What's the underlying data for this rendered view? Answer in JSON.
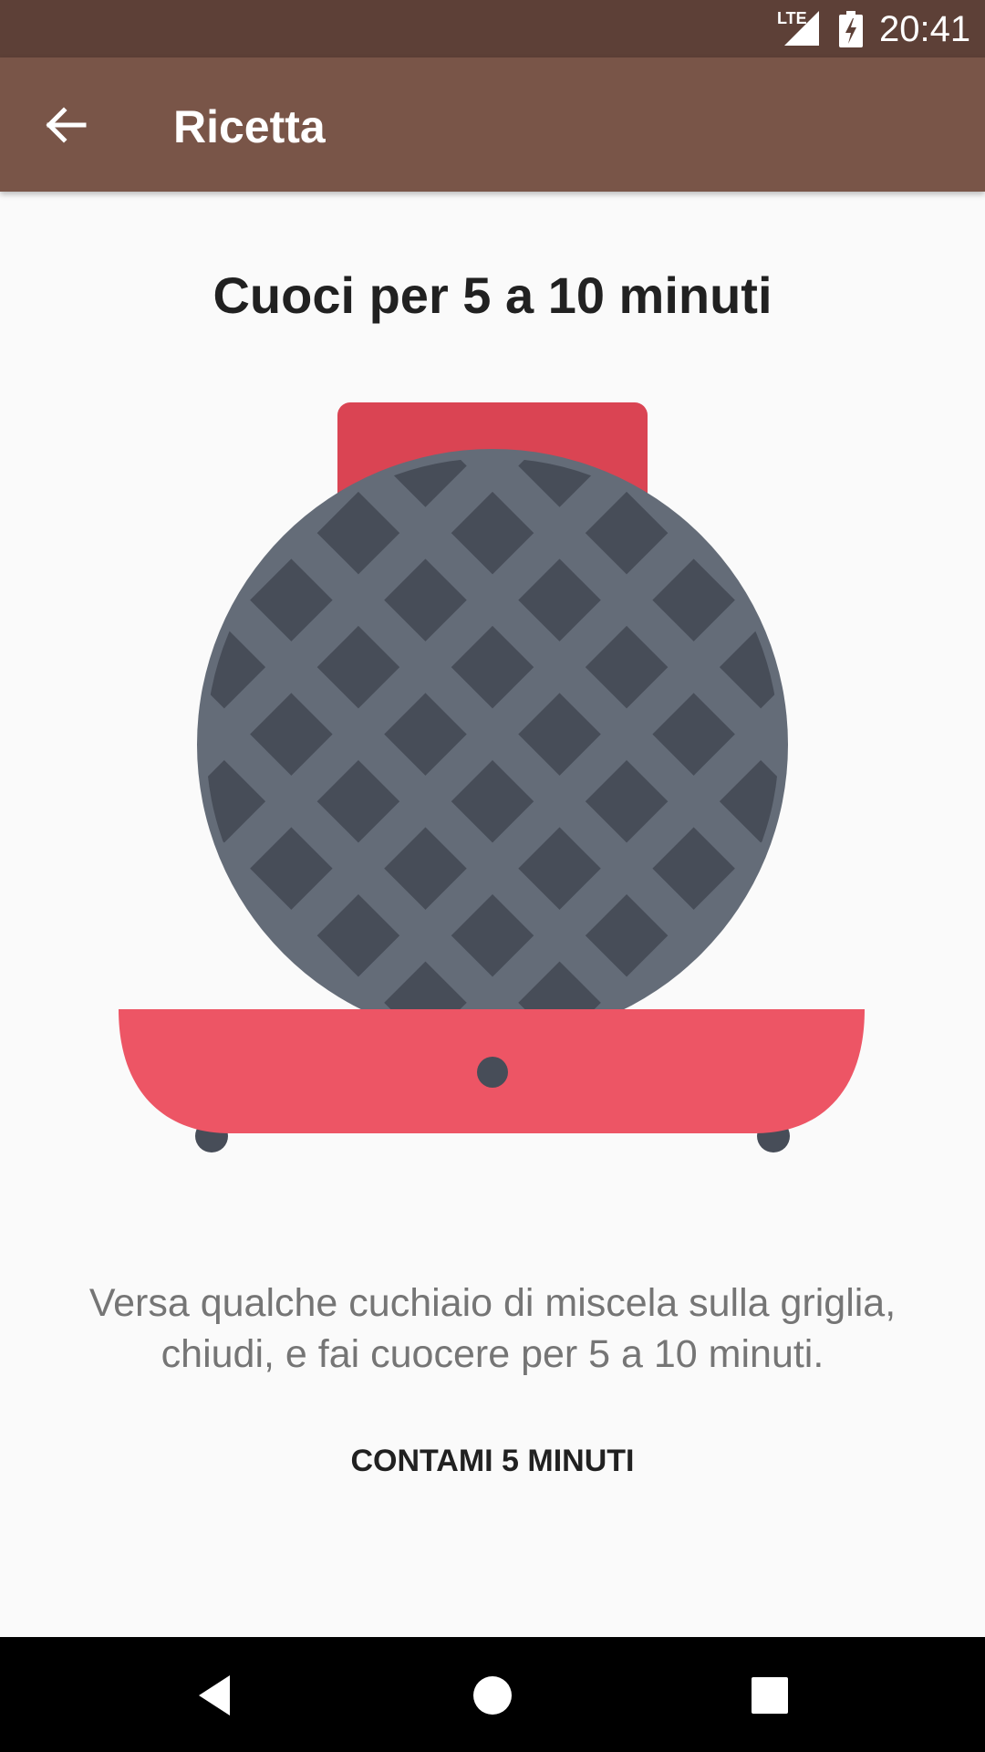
{
  "status_bar": {
    "network_label": "LTE",
    "time": "20:41",
    "icons": [
      "lte-signal-icon",
      "battery-charging-icon"
    ]
  },
  "app_bar": {
    "title": "Ricetta",
    "back_icon": "arrow-back-icon"
  },
  "content": {
    "title": "Cuoci per 5 a 10 minuti",
    "illustration_icon": "waffle-iron-icon",
    "description": "Versa qualche cuchiaio di miscela sulla griglia, chiudi, e fai cuocere per 5 a 10 minuti.",
    "timer_button_label": "CONTAMI 5 MINUTI"
  },
  "nav_bar": {
    "icons": [
      "nav-back-icon",
      "nav-home-icon",
      "nav-recents-icon"
    ]
  },
  "colors": {
    "status_bar": "#5d4037",
    "app_bar": "#795548",
    "waffle_plate": "#646c78",
    "waffle_cells": "#474d58",
    "waffle_base": "#ed5565",
    "waffle_lid": "#da4453"
  }
}
